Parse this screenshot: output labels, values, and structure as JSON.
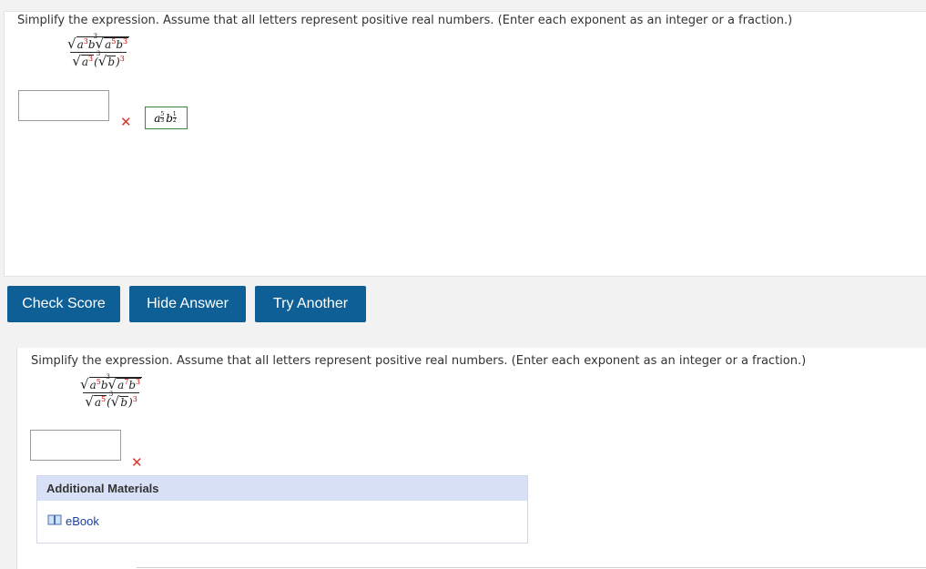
{
  "question1": {
    "prompt": "Simplify the expression. Assume that all letters represent positive real numbers. (Enter each exponent as an integer or a fraction.)",
    "answer_value": "",
    "correct_answer": "a^(5/3) b^(1/2)"
  },
  "question2": {
    "prompt": "Simplify the expression. Assume that all letters represent positive real numbers. (Enter each exponent as an integer or a fraction.)",
    "answer_value": ""
  },
  "buttons": {
    "check_score": "Check Score",
    "hide_answer": "Hide Answer",
    "try_another": "Try Another"
  },
  "additional_materials": {
    "title": "Additional Materials",
    "ebook": "eBook"
  },
  "colors": {
    "button_bg": "#0e5f95",
    "exponent_red": "#cc0000",
    "wrong_mark": "#e0312b",
    "answer_border": "#3a8a3a"
  },
  "icons": [
    "wrong-x-icon",
    "book-icon"
  ]
}
